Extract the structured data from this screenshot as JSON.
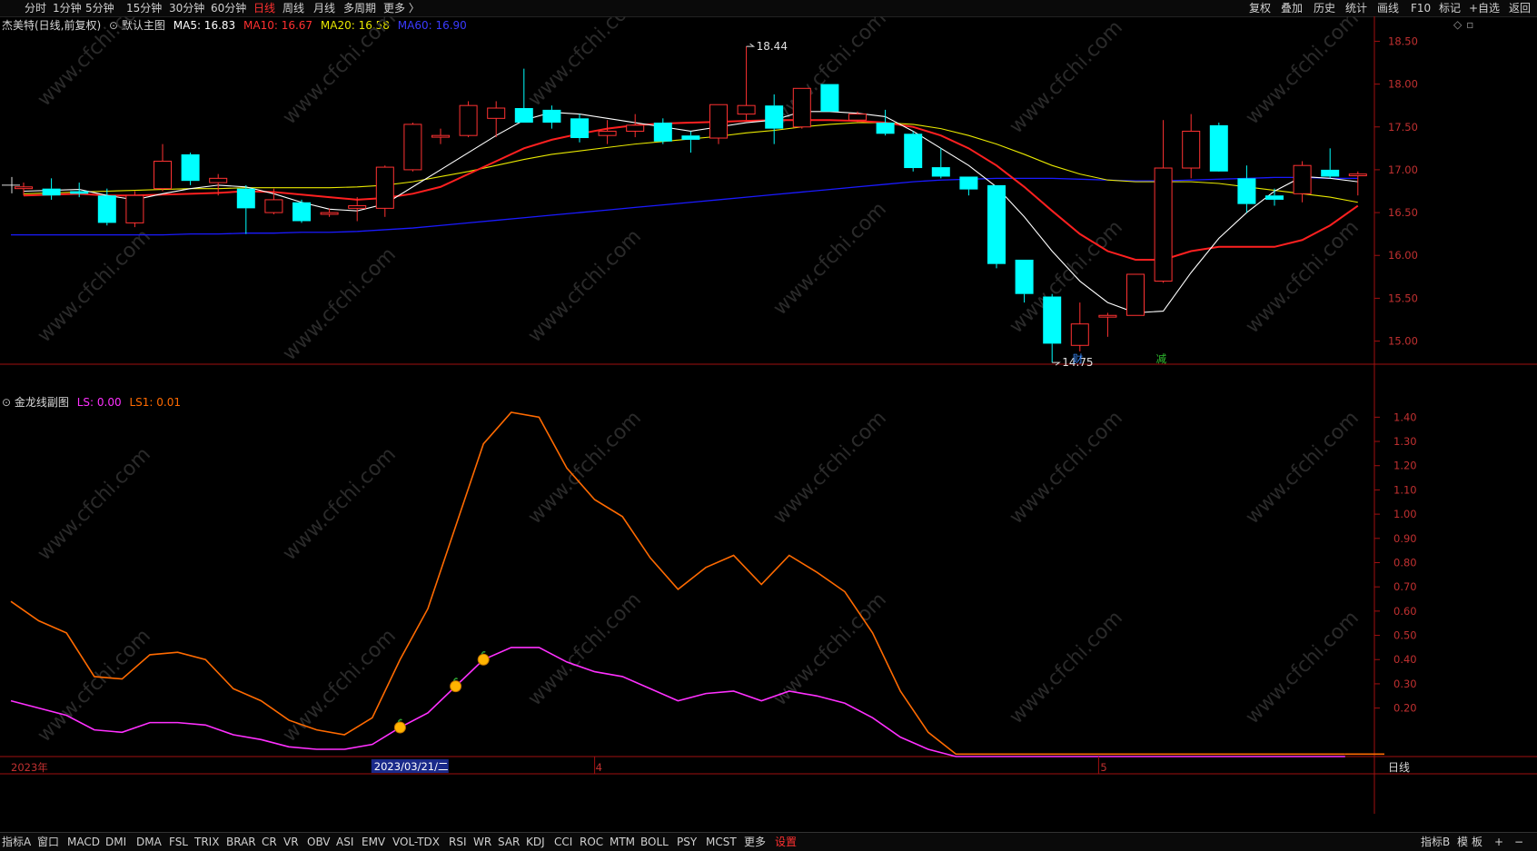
{
  "topbar": {
    "items": [
      "分时",
      "1分钟",
      "5分钟",
      "15分钟",
      "30分钟",
      "60分钟",
      "日线",
      "周线",
      "月线",
      "多周期",
      "更多 〉"
    ],
    "active": "日线",
    "right_items": [
      "复权",
      "叠加",
      "历史",
      "统计",
      "画线",
      "F10",
      "标记",
      "+自选",
      "返回"
    ]
  },
  "main_legend": {
    "stock": "杰美特(日线,前复权)",
    "template": "默认主图",
    "ma5": "MA5: 16.83",
    "ma10": "MA10: 16.67",
    "ma20": "MA20: 16.58",
    "ma60": "MA60: 16.90"
  },
  "sub_legend": {
    "name": "金龙线副图",
    "ls": "LS: 0.00",
    "ls1": "LS1: 0.01"
  },
  "price_axis": [
    "18.50",
    "18.00",
    "17.50",
    "17.00",
    "16.50",
    "16.00",
    "15.50",
    "15.00"
  ],
  "sub_axis": [
    "1.40",
    "1.30",
    "1.20",
    "1.10",
    "1.00",
    "0.90",
    "0.80",
    "0.70",
    "0.60",
    "0.50",
    "0.40",
    "0.30",
    "0.20"
  ],
  "annotations": {
    "high": "18.44",
    "low": "14.75",
    "marker_cai": "财",
    "marker_jian": "减"
  },
  "date_axis": {
    "year": "2023年",
    "cursor_date": "2023/03/21/二",
    "m4": "4",
    "m5": "5",
    "period": "日线"
  },
  "watermark": "www.cfchi.com",
  "colors": {
    "up": "#ff3232",
    "down": "#00ffff",
    "ma5": "#ffffff",
    "ma10": "#ff2020",
    "ma20": "#e8e800",
    "ma60": "#1a1aff",
    "ls": "#ff30ff",
    "ls1": "#ff6a00",
    "frame": "#a01010"
  },
  "chart_data": {
    "type": "candlestick",
    "candles": [
      {
        "o": 16.78,
        "h": 16.85,
        "l": 16.7,
        "c": 16.8
      },
      {
        "o": 16.78,
        "h": 16.9,
        "l": 16.65,
        "c": 16.7
      },
      {
        "o": 16.75,
        "h": 16.85,
        "l": 16.68,
        "c": 16.72
      },
      {
        "o": 16.7,
        "h": 16.78,
        "l": 16.35,
        "c": 16.38
      },
      {
        "o": 16.38,
        "h": 16.75,
        "l": 16.33,
        "c": 16.7
      },
      {
        "o": 16.78,
        "h": 17.3,
        "l": 16.75,
        "c": 17.1
      },
      {
        "o": 17.18,
        "h": 17.2,
        "l": 16.82,
        "c": 16.87
      },
      {
        "o": 16.85,
        "h": 16.95,
        "l": 16.7,
        "c": 16.9
      },
      {
        "o": 16.78,
        "h": 16.82,
        "l": 16.25,
        "c": 16.55
      },
      {
        "o": 16.5,
        "h": 16.78,
        "l": 16.48,
        "c": 16.65
      },
      {
        "o": 16.62,
        "h": 16.65,
        "l": 16.38,
        "c": 16.4
      },
      {
        "o": 16.48,
        "h": 16.55,
        "l": 16.45,
        "c": 16.5
      },
      {
        "o": 16.55,
        "h": 16.68,
        "l": 16.4,
        "c": 16.58
      },
      {
        "o": 16.55,
        "h": 17.05,
        "l": 16.45,
        "c": 17.03
      },
      {
        "o": 17.0,
        "h": 17.55,
        "l": 16.98,
        "c": 17.53
      },
      {
        "o": 17.38,
        "h": 17.48,
        "l": 17.3,
        "c": 17.4
      },
      {
        "o": 17.4,
        "h": 17.8,
        "l": 17.38,
        "c": 17.75
      },
      {
        "o": 17.6,
        "h": 17.8,
        "l": 17.38,
        "c": 17.72
      },
      {
        "o": 17.72,
        "h": 18.18,
        "l": 17.55,
        "c": 17.55
      },
      {
        "o": 17.7,
        "h": 17.75,
        "l": 17.48,
        "c": 17.55
      },
      {
        "o": 17.6,
        "h": 17.65,
        "l": 17.32,
        "c": 17.37
      },
      {
        "o": 17.4,
        "h": 17.58,
        "l": 17.3,
        "c": 17.45
      },
      {
        "o": 17.45,
        "h": 17.65,
        "l": 17.38,
        "c": 17.52
      },
      {
        "o": 17.55,
        "h": 17.6,
        "l": 17.3,
        "c": 17.33
      },
      {
        "o": 17.4,
        "h": 17.45,
        "l": 17.2,
        "c": 17.35
      },
      {
        "o": 17.37,
        "h": 17.55,
        "l": 17.3,
        "c": 17.76
      },
      {
        "o": 17.65,
        "h": 18.44,
        "l": 17.58,
        "c": 17.75
      },
      {
        "o": 17.75,
        "h": 17.88,
        "l": 17.3,
        "c": 17.48
      },
      {
        "o": 17.5,
        "h": 17.95,
        "l": 17.48,
        "c": 17.95
      },
      {
        "o": 18.0,
        "h": 18.0,
        "l": 17.68,
        "c": 17.68
      },
      {
        "o": 17.58,
        "h": 17.68,
        "l": 17.55,
        "c": 17.65
      },
      {
        "o": 17.55,
        "h": 17.7,
        "l": 17.4,
        "c": 17.42
      },
      {
        "o": 17.42,
        "h": 17.45,
        "l": 16.98,
        "c": 17.02
      },
      {
        "o": 17.03,
        "h": 17.25,
        "l": 16.9,
        "c": 16.92
      },
      {
        "o": 16.92,
        "h": 16.92,
        "l": 16.7,
        "c": 16.77
      },
      {
        "o": 16.82,
        "h": 16.82,
        "l": 15.85,
        "c": 15.9
      },
      {
        "o": 15.95,
        "h": 15.95,
        "l": 15.45,
        "c": 15.55
      },
      {
        "o": 15.52,
        "h": 15.55,
        "l": 14.75,
        "c": 14.97
      },
      {
        "o": 14.95,
        "h": 15.45,
        "l": 14.88,
        "c": 15.2
      },
      {
        "o": 15.28,
        "h": 15.33,
        "l": 15.05,
        "c": 15.3
      },
      {
        "o": 15.3,
        "h": 15.78,
        "l": 15.3,
        "c": 15.78
      },
      {
        "o": 15.7,
        "h": 17.58,
        "l": 15.68,
        "c": 17.02
      },
      {
        "o": 17.02,
        "h": 17.65,
        "l": 16.9,
        "c": 17.45
      },
      {
        "o": 17.52,
        "h": 17.55,
        "l": 17.0,
        "c": 16.98
      },
      {
        "o": 16.9,
        "h": 17.05,
        "l": 16.5,
        "c": 16.6
      },
      {
        "o": 16.7,
        "h": 16.78,
        "l": 16.58,
        "c": 16.65
      },
      {
        "o": 16.72,
        "h": 17.1,
        "l": 16.62,
        "c": 17.05
      },
      {
        "o": 17.0,
        "h": 17.25,
        "l": 16.9,
        "c": 16.92
      },
      {
        "o": 16.93,
        "h": 16.98,
        "l": 16.7,
        "c": 16.95
      }
    ],
    "ma5": [
      16.75,
      16.76,
      16.77,
      16.7,
      16.65,
      16.72,
      16.78,
      16.82,
      16.8,
      16.72,
      16.62,
      16.54,
      16.52,
      16.6,
      16.8,
      17.0,
      17.2,
      17.4,
      17.58,
      17.67,
      17.65,
      17.6,
      17.55,
      17.5,
      17.45,
      17.5,
      17.55,
      17.58,
      17.68,
      17.68,
      17.66,
      17.62,
      17.45,
      17.25,
      17.05,
      16.8,
      16.45,
      16.05,
      15.7,
      15.45,
      15.33,
      15.35,
      15.8,
      16.2,
      16.5,
      16.75,
      16.92,
      16.9,
      16.86
    ],
    "ma10": [
      16.7,
      16.71,
      16.72,
      16.7,
      16.7,
      16.71,
      16.72,
      16.73,
      16.75,
      16.74,
      16.71,
      16.68,
      16.65,
      16.67,
      16.72,
      16.8,
      16.95,
      17.1,
      17.25,
      17.35,
      17.42,
      17.48,
      17.52,
      17.54,
      17.55,
      17.56,
      17.57,
      17.58,
      17.58,
      17.58,
      17.57,
      17.55,
      17.5,
      17.4,
      17.25,
      17.05,
      16.8,
      16.52,
      16.25,
      16.05,
      15.95,
      15.95,
      16.05,
      16.1,
      16.1,
      16.1,
      16.18,
      16.35,
      16.58
    ],
    "ma20": [
      16.72,
      16.73,
      16.74,
      16.75,
      16.76,
      16.77,
      16.78,
      16.78,
      16.79,
      16.79,
      16.79,
      16.79,
      16.8,
      16.82,
      16.86,
      16.92,
      16.98,
      17.05,
      17.12,
      17.18,
      17.22,
      17.26,
      17.3,
      17.33,
      17.36,
      17.39,
      17.43,
      17.46,
      17.5,
      17.53,
      17.55,
      17.55,
      17.53,
      17.48,
      17.4,
      17.3,
      17.18,
      17.05,
      16.95,
      16.88,
      16.86,
      16.86,
      16.86,
      16.84,
      16.8,
      16.76,
      16.72,
      16.68,
      16.62
    ],
    "ma60": [
      16.24,
      16.24,
      16.24,
      16.24,
      16.24,
      16.24,
      16.25,
      16.25,
      16.26,
      16.26,
      16.27,
      16.27,
      16.28,
      16.3,
      16.32,
      16.35,
      16.38,
      16.41,
      16.44,
      16.47,
      16.5,
      16.53,
      16.56,
      16.59,
      16.62,
      16.65,
      16.68,
      16.71,
      16.74,
      16.77,
      16.8,
      16.83,
      16.86,
      16.88,
      16.89,
      16.9,
      16.9,
      16.9,
      16.89,
      16.88,
      16.87,
      16.87,
      16.88,
      16.89,
      16.9,
      16.91,
      16.91,
      16.9,
      16.9
    ],
    "ls1": [
      0.64,
      0.56,
      0.51,
      0.33,
      0.32,
      0.42,
      0.43,
      0.4,
      0.28,
      0.23,
      0.15,
      0.11,
      0.09,
      0.16,
      0.4,
      0.61,
      0.95,
      1.29,
      1.42,
      1.4,
      1.19,
      1.06,
      0.99,
      0.82,
      0.69,
      0.78,
      0.83,
      0.71,
      0.83,
      0.76,
      0.68,
      0.51,
      0.27,
      0.1,
      0.01,
      0.01,
      0.01,
      0.01,
      0.01,
      0.01,
      0.01,
      0.01,
      0.01,
      0.01,
      0.01,
      0.01,
      0.01,
      0.01,
      0.01
    ],
    "ls": [
      0.23,
      0.2,
      0.17,
      0.11,
      0.1,
      0.14,
      0.14,
      0.13,
      0.09,
      0.07,
      0.04,
      0.03,
      0.03,
      0.05,
      0.12,
      0.18,
      0.29,
      0.4,
      0.45,
      0.45,
      0.39,
      0.35,
      0.33,
      0.28,
      0.23,
      0.26,
      0.27,
      0.23,
      0.27,
      0.25,
      0.22,
      0.16,
      0.08,
      0.03,
      0.0,
      0.0,
      0.0,
      0.0,
      0.0,
      0.0,
      0.0,
      0.0,
      0.0,
      0.0,
      0.0,
      0.0,
      0.0,
      0.0,
      0.0
    ],
    "signal_indices": [
      14,
      16,
      17
    ],
    "price_range": [
      14.55,
      18.6
    ],
    "sub_range": [
      0.0,
      1.48
    ]
  }
}
